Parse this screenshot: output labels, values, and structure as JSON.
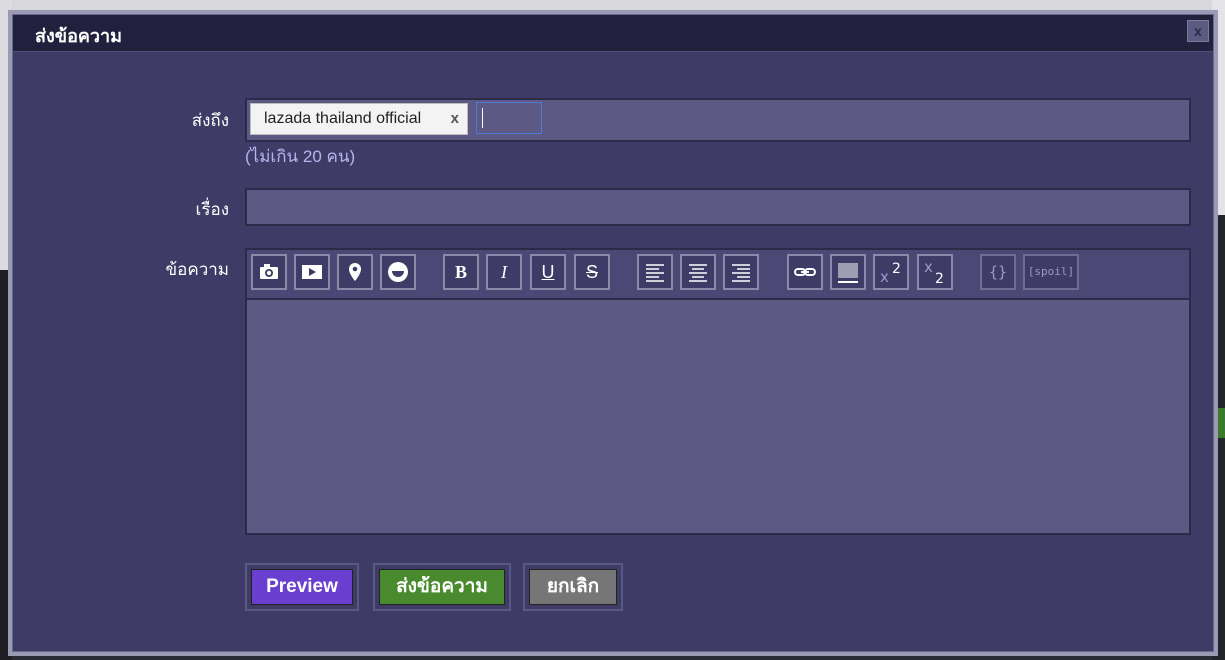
{
  "dialog": {
    "title": "ส่งข้อความ",
    "close_label": "x"
  },
  "form": {
    "to_label": "ส่งถึง",
    "recipient_chip": "lazada thailand official",
    "recipient_remove": "x",
    "to_hint": "(ไม่เกิน 20 คน)",
    "subject_label": "เรื่อง",
    "subject_value": "",
    "message_label": "ข้อความ",
    "message_value": ""
  },
  "toolbar": {
    "bold": "B",
    "italic": "I",
    "underline": "U",
    "strike": "S",
    "code": "{}",
    "spoil": "[spoil]",
    "icons": [
      "camera-icon",
      "youtube-icon",
      "map-pin-icon",
      "emoji-icon",
      "align-left-icon",
      "align-center-icon",
      "align-right-icon",
      "link-icon",
      "barcode-icon",
      "superscript-icon",
      "subscript-icon"
    ]
  },
  "buttons": {
    "preview": "Preview",
    "send": "ส่งข้อความ",
    "cancel": "ยกเลิก"
  },
  "colors": {
    "dialog_bg": "#3e3c66",
    "field_bg": "#5d5985",
    "preview": "#6a3fd0",
    "send": "#4a8a2e",
    "cancel": "#767676"
  }
}
